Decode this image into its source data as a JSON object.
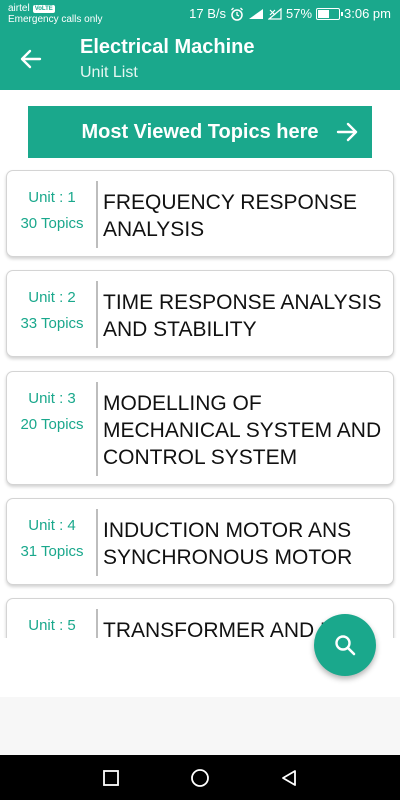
{
  "status_bar": {
    "carrier": "airtel",
    "volte": "VoLTE",
    "emergency": "Emergency calls only",
    "speed": "17 B/s",
    "battery": "57%",
    "battery_level": 0.57,
    "time": "3:06 pm"
  },
  "app_bar": {
    "title": "Electrical Machine",
    "subtitle": "Unit List",
    "back_icon": "arrow-left-icon"
  },
  "banner": {
    "label": "Most Viewed Topics here",
    "icon": "arrow-right-icon"
  },
  "units": [
    {
      "unit": "Unit : 1",
      "topics": "30 Topics",
      "title": "FREQUENCY RESPONSE ANALYSIS"
    },
    {
      "unit": "Unit : 2",
      "topics": "33 Topics",
      "title": "TIME RESPONSE ANALYSIS AND STABILITY"
    },
    {
      "unit": "Unit : 3",
      "topics": "20 Topics",
      "title": "MODELLING OF MECHANICAL SYSTEM AND CONTROL SYSTEM"
    },
    {
      "unit": "Unit : 4",
      "topics": "31 Topics",
      "title": "INDUCTION MOTOR ANS SYNCHRONOUS MOTOR"
    },
    {
      "unit": "Unit : 5",
      "topics": "",
      "title": "TRANSFORMER AND D"
    }
  ],
  "fab": {
    "icon": "search-icon"
  },
  "colors": {
    "accent": "#1aa88c",
    "background": "#ffffff",
    "nav": "#000000"
  }
}
